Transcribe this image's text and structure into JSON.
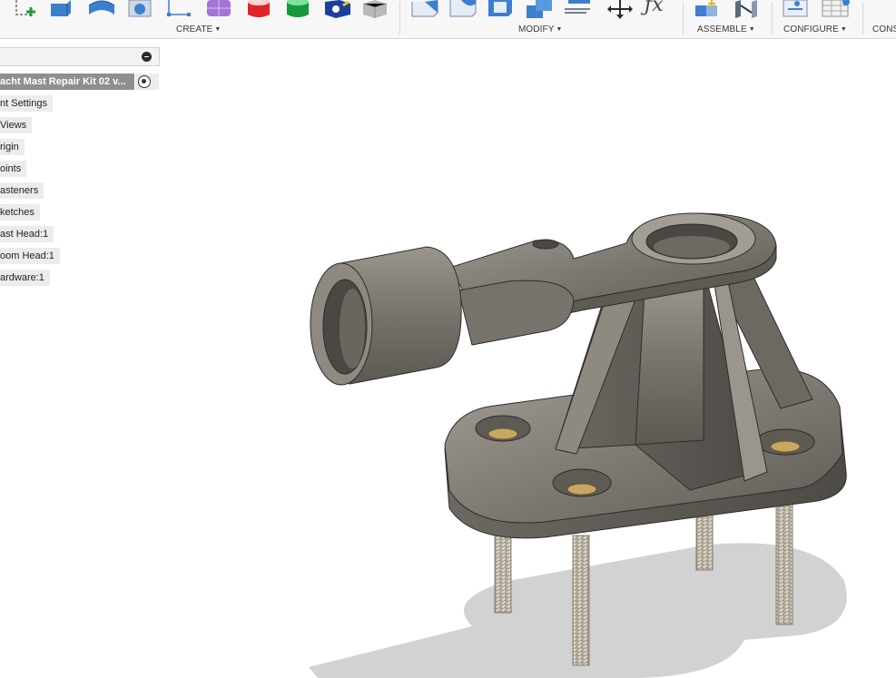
{
  "toolbar": {
    "groups": {
      "create": "CREATE",
      "modify": "MODIFY",
      "assemble": "ASSEMBLE",
      "configure": "CONFIGURE",
      "construct": "CONS"
    },
    "icons": [
      "create-sketch-icon",
      "extrude-icon",
      "revolve-icon",
      "hole-icon",
      "line-icon",
      "form-icon",
      "cylinder-icon",
      "box-icon",
      "insert-icon",
      "solid-icon",
      "press-pull-icon",
      "fillet-icon",
      "shell-icon",
      "combine-icon",
      "align-icon",
      "move-icon",
      "parameters-icon",
      "new-component-icon",
      "joint-icon",
      "configure-icon",
      "table-icon"
    ],
    "parameters_glyph": "ƒx"
  },
  "browser": {
    "root": "acht Mast Repair Kit 02 v...",
    "items": [
      "nt Settings",
      "Views",
      "rigin",
      "oints",
      "asteners",
      "ketches",
      "ast Head:1",
      "oom Head:1",
      "ardware:1"
    ]
  },
  "colors": {
    "toolbar_bg": "#f7f7f7",
    "root_row_bg": "#8f8f8f",
    "model_metal": "#8a867f",
    "brass": "#c8a860",
    "shadow": "#d2d2d2"
  }
}
